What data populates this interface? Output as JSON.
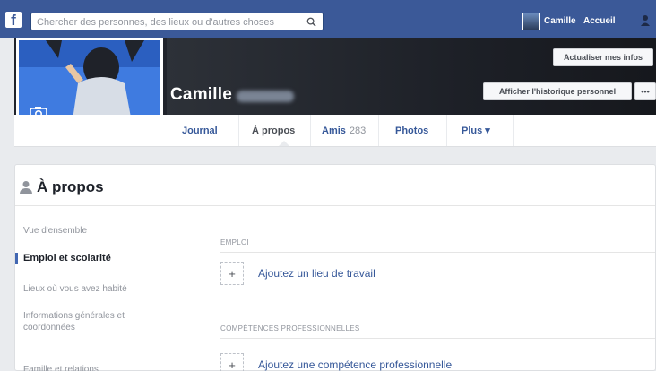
{
  "colors": {
    "facebook_blue": "#3b5998",
    "link_blue": "#365899",
    "active_bar": "#4267b2",
    "page_bg": "#e9ebee"
  },
  "topbar": {
    "logo_icon": "facebook-f-icon",
    "search_placeholder": "Chercher des personnes, des lieux ou d'autres choses",
    "search_icon": "search-icon",
    "user_name": "Camille",
    "home_label": "Accueil"
  },
  "profile": {
    "name": "Camille",
    "update_info_button": "Actualiser mes infos",
    "activity_log_button": "Afficher l'historique personnel",
    "more_button": "•••",
    "camera_icon": "camera-icon"
  },
  "tabs": [
    {
      "label": "Journal"
    },
    {
      "label": "À propos"
    },
    {
      "label": "Amis",
      "count": "283"
    },
    {
      "label": "Photos"
    },
    {
      "label": "Plus ▾"
    }
  ],
  "about": {
    "title": "À propos",
    "icon": "person-icon",
    "sidebar": [
      {
        "label": "Vue d'ensemble"
      },
      {
        "label": "Emploi et scolarité"
      },
      {
        "label": "Lieux où vous avez habité"
      },
      {
        "label": "Informations générales et coordonnées"
      },
      {
        "label": "Famille et relations"
      }
    ],
    "sections": [
      {
        "label": "EMPLOI",
        "action": "Ajoutez un lieu de travail"
      },
      {
        "label": "COMPÉTENCES PROFESSIONNELLES",
        "action": "Ajoutez une compétence professionnelle"
      }
    ]
  }
}
